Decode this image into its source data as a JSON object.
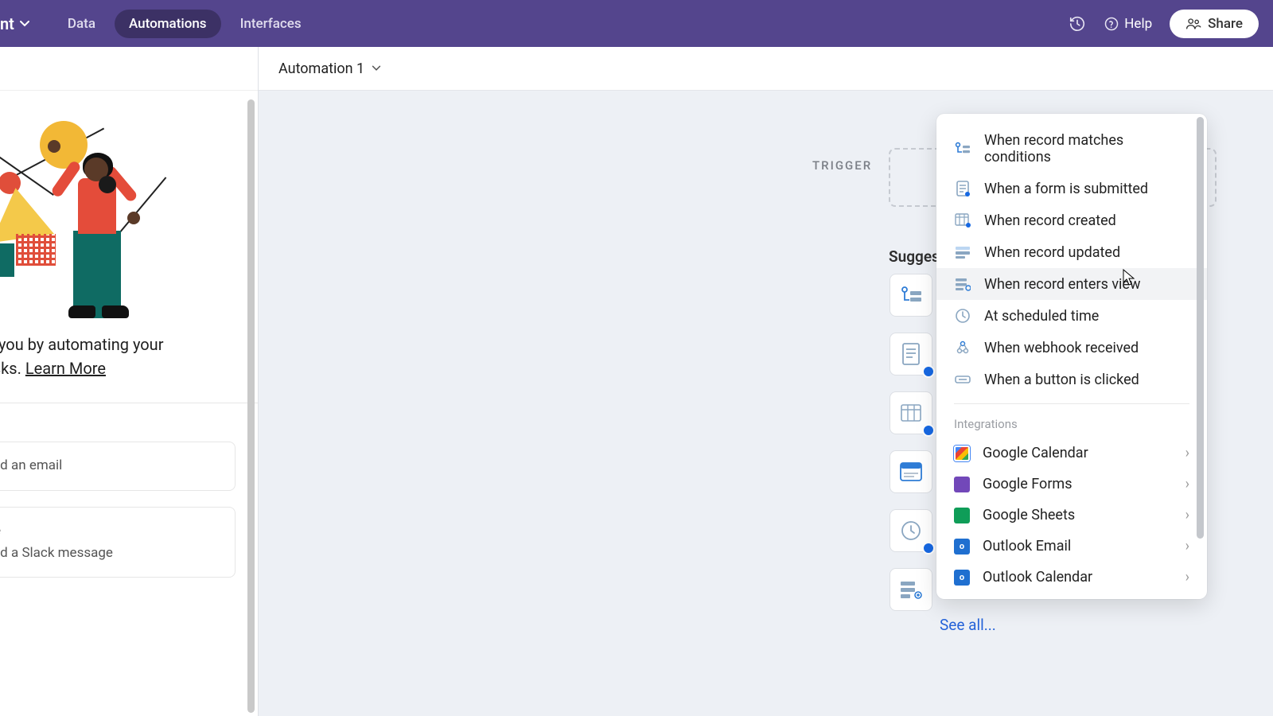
{
  "header": {
    "base_name_partial": "nt",
    "tabs": {
      "data": "Data",
      "automations": "Automations",
      "interfaces": "Interfaces"
    },
    "help": "Help",
    "share": "Share"
  },
  "side": {
    "desc_line1": "rk for you by automating your",
    "desc_line2": "on tasks. ",
    "learn_more": "Learn More",
    "cards": [
      {
        "title_partial": "",
        "sub": "send an email"
      },
      {
        "title_partial": "age",
        "sub": "send a Slack message"
      }
    ]
  },
  "main": {
    "automation_name": "Automation 1",
    "trigger_label": "TRIGGER",
    "suggested_label": "Suggest",
    "see_all": "See all..."
  },
  "popover": {
    "triggers": [
      {
        "id": "record-matches",
        "label": "When record matches conditions"
      },
      {
        "id": "form-submitted",
        "label": "When a form is submitted"
      },
      {
        "id": "record-created",
        "label": "When record created"
      },
      {
        "id": "record-updated",
        "label": "When record updated"
      },
      {
        "id": "record-enters-view",
        "label": "When record enters view",
        "hover": true
      },
      {
        "id": "scheduled-time",
        "label": "At scheduled time"
      },
      {
        "id": "webhook-received",
        "label": "When webhook received"
      },
      {
        "id": "button-clicked",
        "label": "When a button is clicked"
      }
    ],
    "integrations_label": "Integrations",
    "integrations": [
      {
        "id": "google-calendar",
        "label": "Google Calendar",
        "icon": "ic-gcal"
      },
      {
        "id": "google-forms",
        "label": "Google Forms",
        "icon": "ic-gform"
      },
      {
        "id": "google-sheets",
        "label": "Google Sheets",
        "icon": "ic-gsheet"
      },
      {
        "id": "outlook-email",
        "label": "Outlook Email",
        "icon": "ic-oemail"
      },
      {
        "id": "outlook-calendar",
        "label": "Outlook Calendar",
        "icon": "ic-ocal"
      }
    ]
  }
}
